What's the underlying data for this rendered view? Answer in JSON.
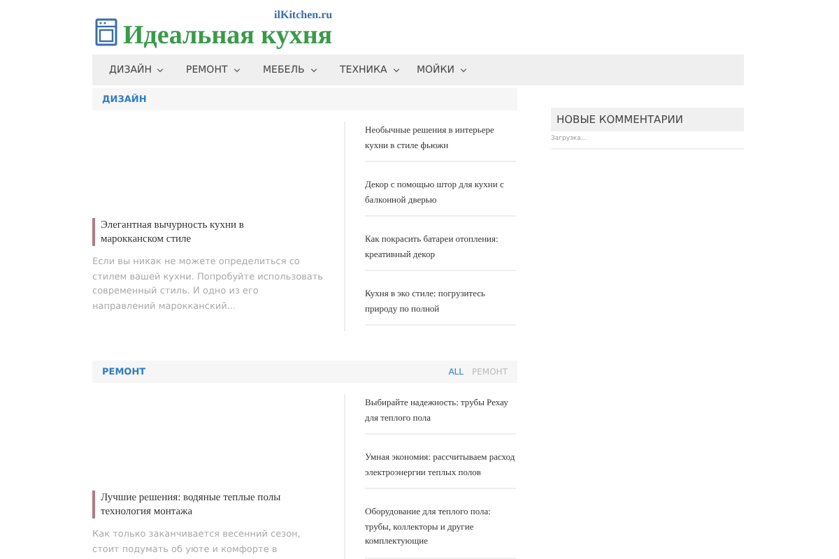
{
  "logo": {
    "domain": "ilKitchen.ru",
    "name": "Идеальная кухня"
  },
  "nav": [
    {
      "label": "ДИЗАЙН"
    },
    {
      "label": "РЕМОНТ"
    },
    {
      "label": "МЕБЕЛЬ"
    },
    {
      "label": "ТЕХНИКА"
    },
    {
      "label": "МОЙКИ"
    }
  ],
  "sections": [
    {
      "title": "ДИЗАЙН",
      "featured": {
        "title": "Элегантная вычурность кухни в марокканском стиле",
        "excerpt": "Если вы никак не можете определиться со стилем вашей кухни. Попробуйте использовать современный стиль. И одно из его направлений марокканский..."
      },
      "posts": [
        {
          "title": "Необычные решения в интерьере кухни в стиле фьюжн"
        },
        {
          "title": "Декор с помощью штор для кухни с балконной дверью"
        },
        {
          "title": "Как покрасить батареи отопления: креативный декор"
        },
        {
          "title": "Кухня в эко стиле: погрузитесь природу по полной"
        }
      ]
    },
    {
      "title": "РЕМОНТ",
      "filters": [
        {
          "label": "ALL",
          "selected": true
        },
        {
          "label": "РЕМОНТ",
          "selected": false
        }
      ],
      "featured": {
        "title": "Лучшие решения: водяные теплые полы технология монтажа",
        "excerpt": "Как только заканчивается весенний сезон, стоит подумать об уюте и комфорте в"
      },
      "posts": [
        {
          "title": "Выбирайте надежность: трубы Рехау для теплого пола"
        },
        {
          "title": "Умная экономия: рассчитываем расход электроэнергии теплых полов"
        },
        {
          "title": "Оборудование для теплого пола: трубы, коллекторы и другие комплектующие"
        }
      ]
    }
  ],
  "sidebar": {
    "widget_title": "НОВЫЕ КОММЕНТАРИИ",
    "loading": "Загрузка..."
  }
}
